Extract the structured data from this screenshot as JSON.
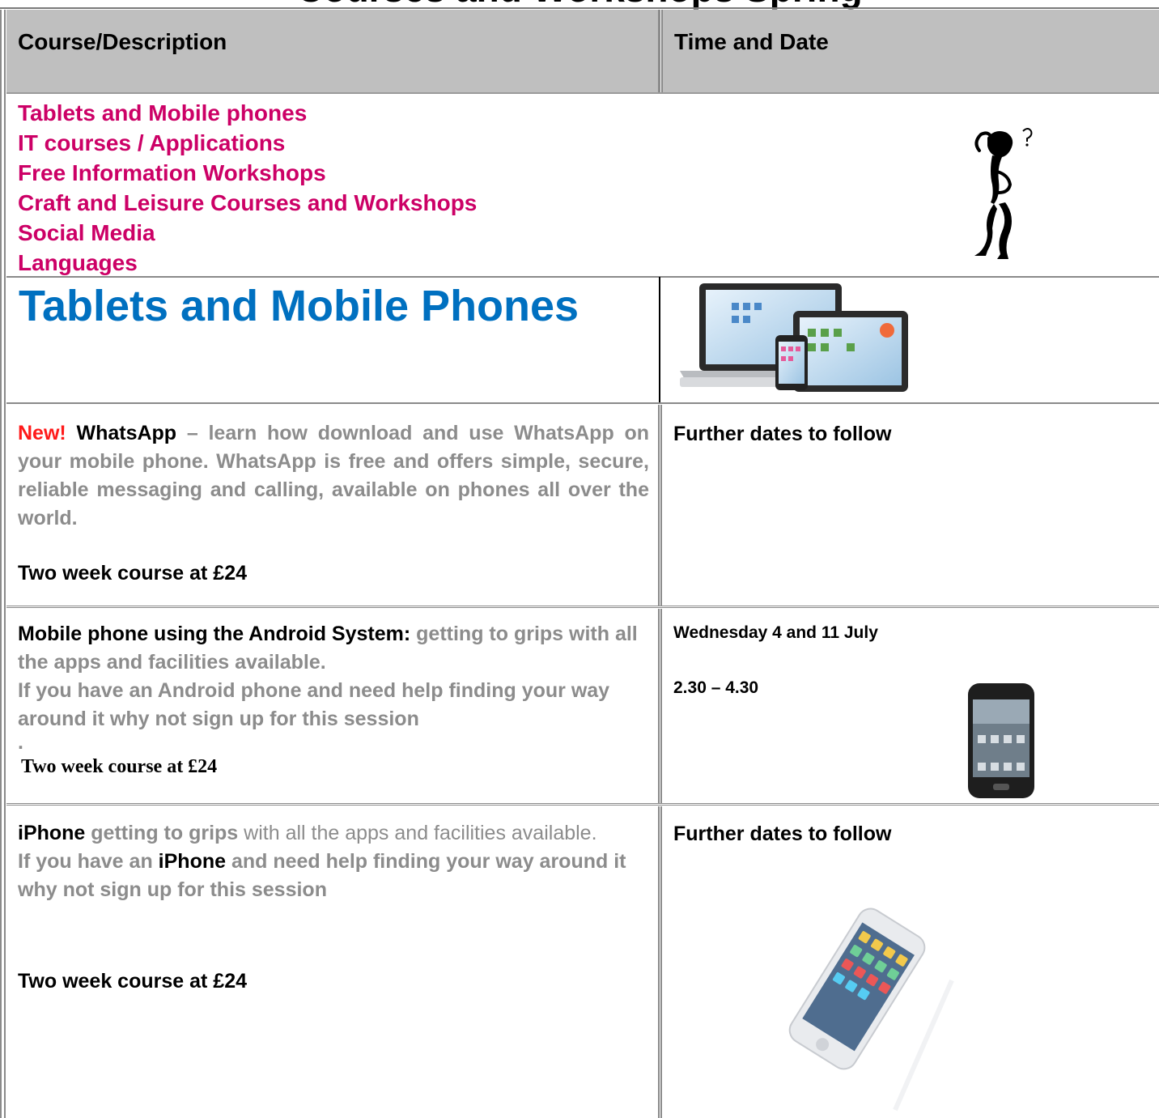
{
  "title": "Courses and Workshops Spring",
  "header": {
    "course_col": "Course/Description",
    "time_col": "Time and Date"
  },
  "categories": [
    "Tablets and Mobile phones",
    "IT courses / Applications",
    "Free Information Workshops",
    "Craft and Leisure Courses and Workshops",
    "Social Media",
    "Languages"
  ],
  "section": {
    "title": "Tablets and Mobile Phones"
  },
  "courses": [
    {
      "new_tag": "New!",
      "name": "WhatsApp",
      "dash": " – ",
      "description": "learn how download and use WhatsApp on your mobile phone. WhatsApp is free and offers simple, secure, reliable messaging and calling, available on phones all over the world.",
      "price": "Two week course at £24",
      "when": "Further dates to follow"
    },
    {
      "name": "Mobile phone using the Android System:",
      "description": " getting to grips with all the apps and facilities available.",
      "description2": " If you have an Android phone and need help finding your way around it why not sign  up for this session",
      "stray": ".",
      "price": "Two week course at £24",
      "date": "Wednesday 4 and 11 July",
      "time": "2.30 – 4.30"
    },
    {
      "name": "iPhone",
      "part1": " getting to grips",
      "part2": " with all the apps and facilities available.",
      "line2_a": " If you have an ",
      "line2_name": "iPhone",
      "line2_b": " and need help finding your way around it why not sign  up for this session",
      "price": "Two week course at £24",
      "when": "Further dates to follow"
    }
  ],
  "colors": {
    "category": "#cc0066",
    "section_title": "#0070c0",
    "new_tag": "#ff1a1a",
    "description": "#8c8c8c",
    "header_bg": "#bfbfbf"
  }
}
